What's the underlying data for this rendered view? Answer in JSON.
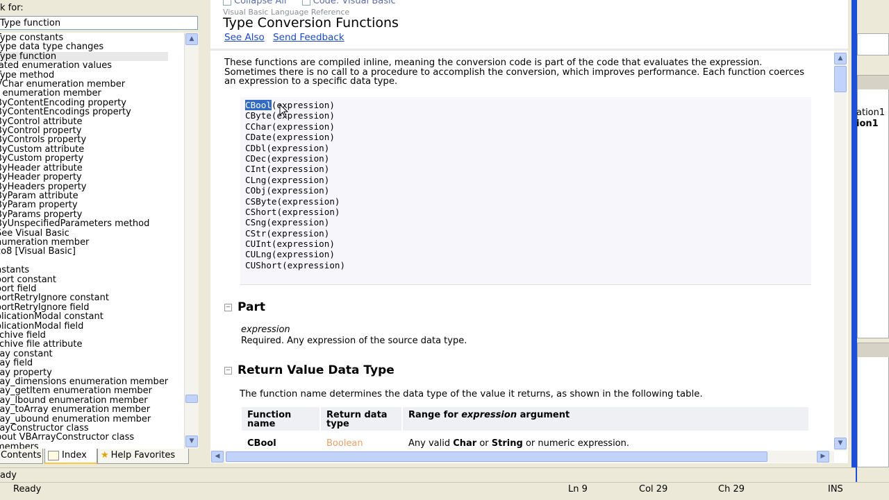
{
  "index_pane": {
    "look_for_label": "k for:",
    "look_for_value": "Type function",
    "items": [
      "Type constants",
      "Type data type changes",
      "Type function",
      "Iated enumeration values",
      "Type method",
      "VChar enumeration member",
      "r enumeration member",
      "ByContentEncoding property",
      "ByContentEncodings property",
      "ByControl attribute",
      "ByControl property",
      "ByControls property",
      "ByCustom attribute",
      "ByCustom property",
      "ByHeader attribute",
      "ByHeader property",
      "ByHeaders property",
      "ByParam attribute",
      "ByParam property",
      "ByParams property",
      "ByUnspecifiedParameters method",
      "See Visual Basic",
      "numeration member",
      "co8 [Visual Basic]",
      "",
      "nstants",
      "oort constant",
      "oort field",
      "oortRetryIgnore constant",
      "oortRetryIgnore field",
      "olicationModal constant",
      "olicationModal field",
      "rchive field",
      "rchive file attribute",
      "ray constant",
      "ray field",
      "ray property",
      "ray_dimensions enumeration member",
      "ray_getItem enumeration member",
      "ray_lbound enumeration member",
      "ray_toArray enumeration member",
      "ray_ubound enumeration member",
      "rayConstructor class",
      "bout VBArrayConstructor class",
      "members"
    ],
    "selected_index": 2,
    "tabs": {
      "contents": "Contents",
      "index": "Index",
      "help_favorites": "Help Favorites"
    }
  },
  "document": {
    "collapse_all": "Collapse All",
    "code_filter": "Code: Visual Basic",
    "reference": "Visual Basic Language Reference",
    "title": "Type Conversion Functions",
    "links": [
      "See Also",
      "Send Feedback"
    ],
    "intro": "These functions are compiled inline, meaning the conversion code is part of the code that evaluates the expression. Sometimes there is no call to a procedure to accomplish the conversion, which improves performance. Each function coerces an expression to a specific data type.",
    "code_lines": [
      {
        "fn": "CBool",
        "arg": "(expression)"
      },
      {
        "fn": "CByte",
        "arg": "(expression)"
      },
      {
        "fn": "CChar",
        "arg": "(expression)"
      },
      {
        "fn": "CDate",
        "arg": "(expression)"
      },
      {
        "fn": "CDbl",
        "arg": "(expression)"
      },
      {
        "fn": "CDec",
        "arg": "(expression)"
      },
      {
        "fn": "CInt",
        "arg": "(expression)"
      },
      {
        "fn": "CLng",
        "arg": "(expression)"
      },
      {
        "fn": "CObj",
        "arg": "(expression)"
      },
      {
        "fn": "CSByte",
        "arg": "(expression)"
      },
      {
        "fn": "CShort",
        "arg": "(expression)"
      },
      {
        "fn": "CSng",
        "arg": "(expression)"
      },
      {
        "fn": "CStr",
        "arg": "(expression)"
      },
      {
        "fn": "CUInt",
        "arg": "(expression)"
      },
      {
        "fn": "CULng",
        "arg": "(expression)"
      },
      {
        "fn": "CUShort",
        "arg": "(expression)"
      }
    ],
    "part": {
      "heading": "Part",
      "term": "expression",
      "description": "Required. Any expression of the source data type."
    },
    "return_value": {
      "heading": "Return Value Data Type",
      "description": "The function name determines the data type of the value it returns, as shown in the following table.",
      "table": {
        "col1": "Function name",
        "col2": "Return data type",
        "col3_prefix": "Range for ",
        "col3_italic": "expression",
        "col3_suffix": " argument",
        "row1": {
          "fn": "CBool",
          "type": "Boolean",
          "range_prefix": "Any valid ",
          "range_b1": "Char",
          "range_mid": " or ",
          "range_b2": "String",
          "range_suffix": " or numeric expression."
        }
      }
    }
  },
  "right_pane": {
    "text1": "ation1",
    "text2": "ion1"
  },
  "status": {
    "pane_text": "ady",
    "main_text": "Ready",
    "ln": "Ln 9",
    "col": "Col 29",
    "ch": "Ch 29",
    "ins": "INS"
  }
}
